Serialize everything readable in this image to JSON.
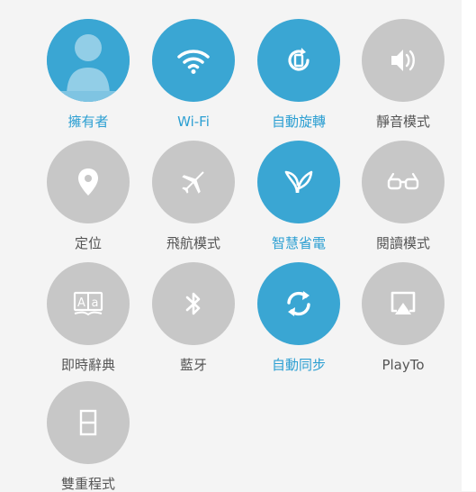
{
  "tiles": [
    {
      "label": "擁有者",
      "icon": "user-avatar-icon",
      "active": true
    },
    {
      "label": "Wi-Fi",
      "icon": "wifi-icon",
      "active": true
    },
    {
      "label": "自動旋轉",
      "icon": "auto-rotate-icon",
      "active": true
    },
    {
      "label": "靜音模式",
      "icon": "volume-icon",
      "active": false
    },
    {
      "label": "定位",
      "icon": "location-pin-icon",
      "active": false
    },
    {
      "label": "飛航模式",
      "icon": "airplane-icon",
      "active": false
    },
    {
      "label": "智慧省電",
      "icon": "leaf-icon",
      "active": true
    },
    {
      "label": "閱讀模式",
      "icon": "glasses-icon",
      "active": false
    },
    {
      "label": "即時辭典",
      "icon": "dictionary-icon",
      "active": false
    },
    {
      "label": "藍牙",
      "icon": "bluetooth-icon",
      "active": false
    },
    {
      "label": "自動同步",
      "icon": "sync-icon",
      "active": true
    },
    {
      "label": "PlayTo",
      "icon": "playto-icon",
      "active": false
    },
    {
      "label": "雙重程式",
      "icon": "dual-app-icon",
      "active": false
    }
  ],
  "colors": {
    "active": "#3aa6d3",
    "inactive": "#c7c7c7",
    "active_text": "#2c9fd2",
    "inactive_text": "#555555",
    "background": "#f4f4f4"
  }
}
